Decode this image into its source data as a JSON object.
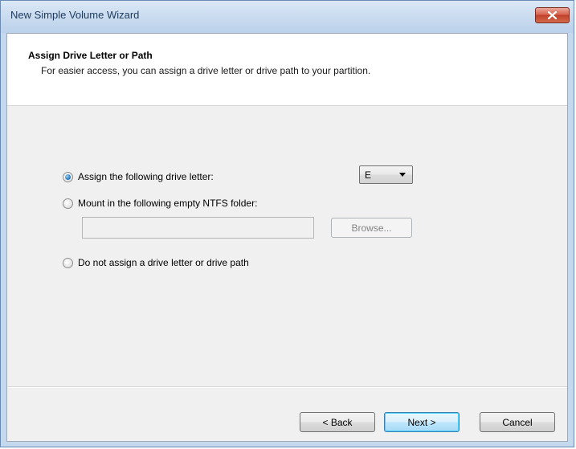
{
  "window": {
    "title": "New Simple Volume Wizard",
    "close_icon": "close-x-icon"
  },
  "header": {
    "title": "Assign Drive Letter or Path",
    "subtitle": "For easier access, you can assign a drive letter or drive path to your partition."
  },
  "options": {
    "assign_letter": {
      "label": "Assign the following drive letter:",
      "selected": true
    },
    "mount_folder": {
      "label": "Mount in the following empty NTFS folder:",
      "selected": false,
      "path_value": "",
      "browse_label": "Browse..."
    },
    "no_assign": {
      "label": "Do not assign a drive letter or drive path",
      "selected": false
    }
  },
  "drive_letter": {
    "selected": "E"
  },
  "footer": {
    "back_label": "< Back",
    "next_label": "Next >",
    "cancel_label": "Cancel"
  },
  "colors": {
    "title_text": "#1e395b",
    "close_button": "#c0402a",
    "default_button_border": "#3c7fb1"
  }
}
